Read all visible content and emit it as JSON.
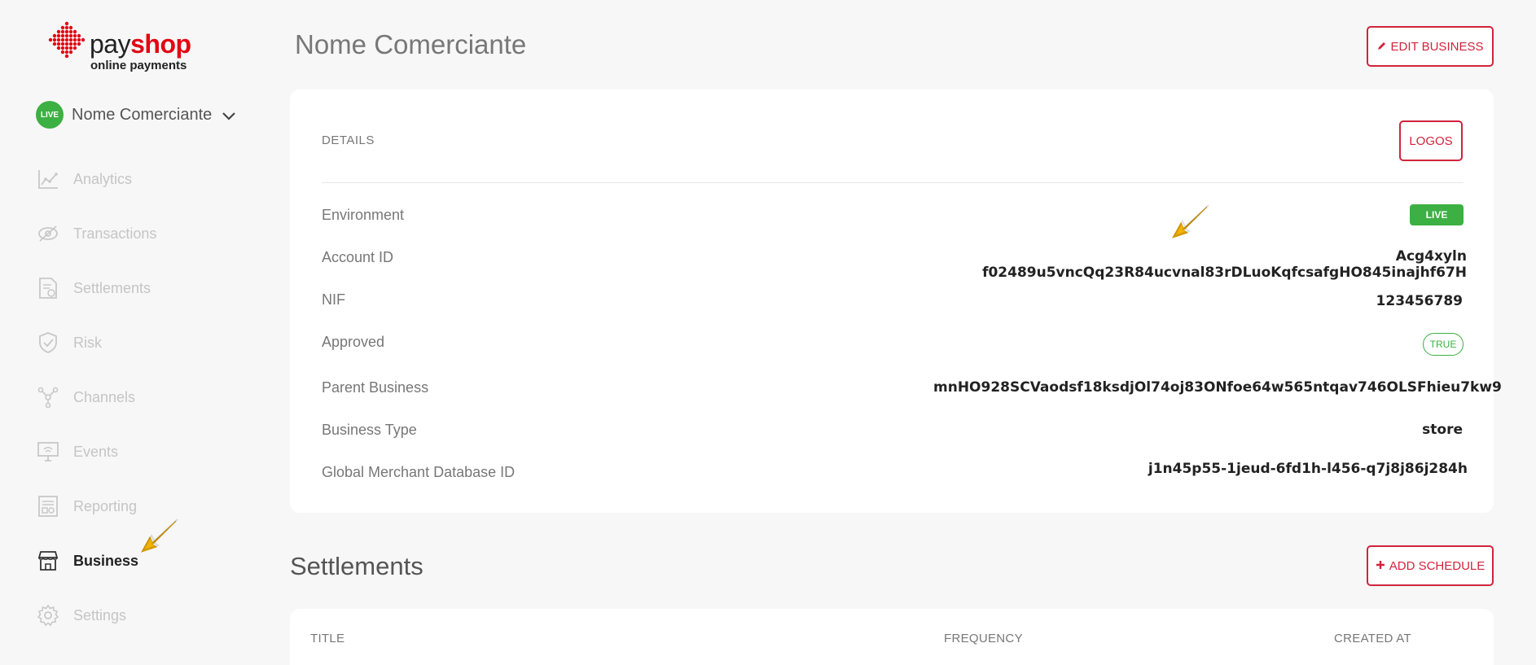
{
  "brand": {
    "name_part1": "pay",
    "name_part2": "shop",
    "tagline": "online payments",
    "accent_color": "#e30613"
  },
  "merchant_selector": {
    "badge": "LIVE",
    "name": "Nome Comerciante",
    "icon": "chevron-down-icon"
  },
  "sidebar": {
    "items": [
      {
        "label": "Analytics",
        "icon": "chart-line-icon",
        "active": false
      },
      {
        "label": "Transactions",
        "icon": "transactions-icon",
        "active": false
      },
      {
        "label": "Settlements",
        "icon": "document-icon",
        "active": false
      },
      {
        "label": "Risk",
        "icon": "shield-check-icon",
        "active": false
      },
      {
        "label": "Channels",
        "icon": "network-icon",
        "active": false
      },
      {
        "label": "Events",
        "icon": "monitor-icon",
        "active": false
      },
      {
        "label": "Reporting",
        "icon": "report-icon",
        "active": false
      },
      {
        "label": "Business",
        "icon": "store-icon",
        "active": true
      },
      {
        "label": "Settings",
        "icon": "gear-icon",
        "active": false
      }
    ]
  },
  "page": {
    "title": "Nome Comerciante",
    "edit_button": "EDIT BUSINESS"
  },
  "details": {
    "section_label": "DETAILS",
    "logos_button": "LOGOS",
    "rows": {
      "environment": {
        "label": "Environment",
        "value": "LIVE"
      },
      "account_id": {
        "label": "Account ID",
        "value": "Acg4xyln f02489u5vncQq23R84ucvnal83rDLuoKqfcsafgHO845inajhf67H"
      },
      "nif": {
        "label": "NIF",
        "value": "123456789"
      },
      "approved": {
        "label": "Approved",
        "value": "TRUE"
      },
      "parent_business": {
        "label": "Parent Business",
        "value": "mnHO928SCVaodsf18ksdjOl74oj83ONfoe64w565ntqav746OLSFhieu7kw9"
      },
      "business_type": {
        "label": "Business Type",
        "value": "store"
      },
      "gmd_id": {
        "label": "Global Merchant Database ID",
        "value": "j1n45p55-1jeud-6fd1h-l456-q7j8j86j284h"
      }
    }
  },
  "settlements": {
    "title": "Settlements",
    "add_button": "ADD SCHEDULE",
    "columns": [
      "TITLE",
      "FREQUENCY",
      "CREATED AT"
    ]
  },
  "colors": {
    "live_green": "#3cb043",
    "button_red": "#d0243c",
    "annotation_arrow": "#f5b400"
  }
}
